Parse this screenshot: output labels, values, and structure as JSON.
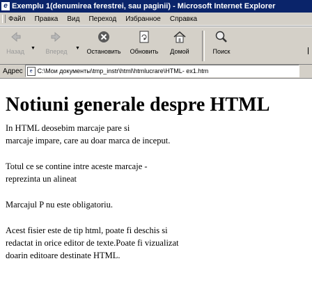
{
  "window": {
    "title": "Exemplu 1(denumirea ferestrei, sau paginii) - Microsoft Internet Explorer"
  },
  "menu": {
    "items": [
      "Файл",
      "Правка",
      "Вид",
      "Переход",
      "Избранное",
      "Справка"
    ]
  },
  "toolbar": {
    "back_label": "Назад",
    "forward_label": "Вперед",
    "stop_label": "Остановить",
    "refresh_label": "Обновить",
    "home_label": "Домой",
    "search_label": "Поиск"
  },
  "address": {
    "label": "Адрес",
    "url": "C:\\Мои документы\\tmp_instr\\html\\htmlucrare\\HTML- ex1.htm"
  },
  "page": {
    "heading": "Notiuni generale despre HTML",
    "para1_line1": "In HTML deosebim marcaje pare si",
    "para1_line2": "marcaje impare, care au doar marca de inceput.",
    "para2_line1": "Totul ce se contine intre aceste marcaje -",
    "para2_line2": "reprezinta un alineat",
    "para3": "Marcajul P nu este obligatoriu.",
    "para4_line1": "Acest fisier este de tip html, poate fi deschis si",
    "para4_line2": "redactat in orice editor de texte.Poate fi vizualizat",
    "para4_line3": "doarin editoare destinate HTML."
  }
}
